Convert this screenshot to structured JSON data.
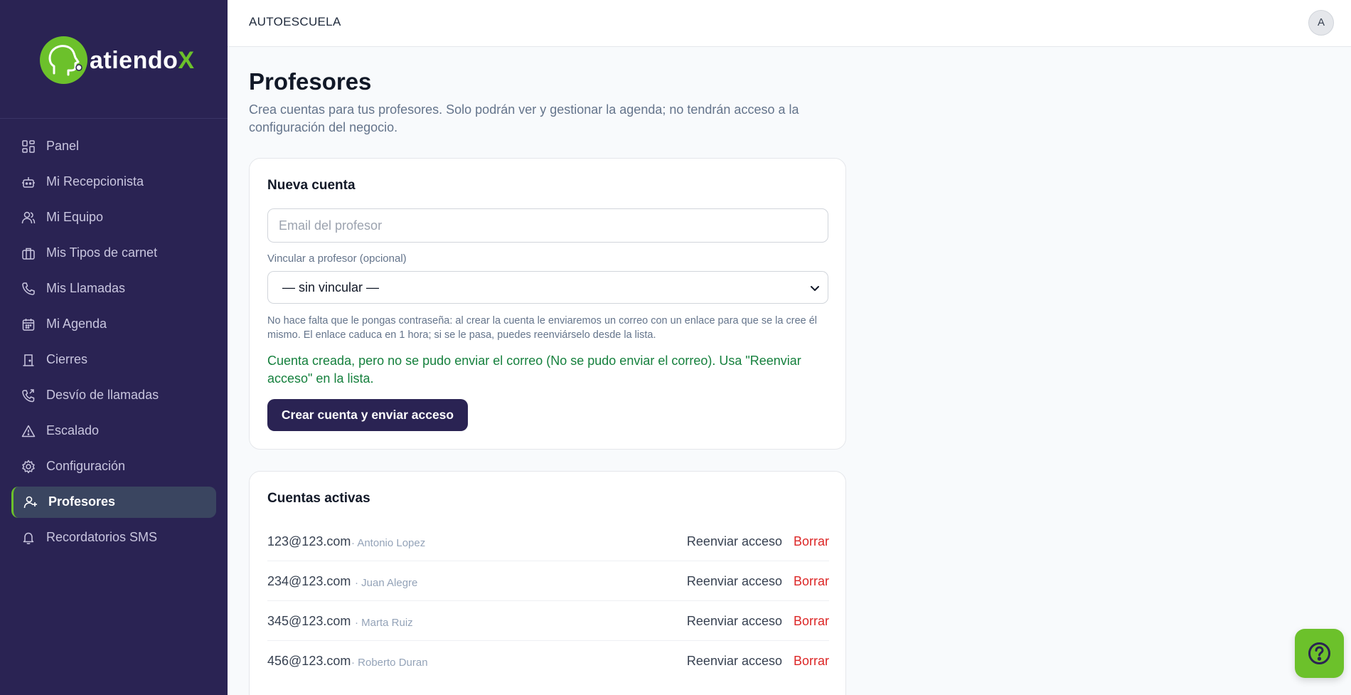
{
  "brand": {
    "name_prefix": "atiendo",
    "name_suffix": "X",
    "accent": "#6cc12b",
    "sidebar_bg": "#2a2353"
  },
  "sidebar": {
    "items": [
      {
        "label": "Panel",
        "icon": "dashboard-icon"
      },
      {
        "label": "Mi Recepcionista",
        "icon": "robot-icon"
      },
      {
        "label": "Mi Equipo",
        "icon": "users-icon"
      },
      {
        "label": "Mis Tipos de carnet",
        "icon": "briefcase-icon"
      },
      {
        "label": "Mis Llamadas",
        "icon": "phone-icon"
      },
      {
        "label": "Mi Agenda",
        "icon": "calendar-icon"
      },
      {
        "label": "Cierres",
        "icon": "door-icon"
      },
      {
        "label": "Desvío de llamadas",
        "icon": "phone-forward-icon"
      },
      {
        "label": "Escalado",
        "icon": "warning-icon"
      },
      {
        "label": "Configuración",
        "icon": "gear-icon"
      },
      {
        "label": "Profesores",
        "icon": "user-plus-icon",
        "active": true
      },
      {
        "label": "Recordatorios SMS",
        "icon": "bell-icon"
      }
    ]
  },
  "header": {
    "business": "AUTOESCUELA",
    "avatar_initial": "A"
  },
  "page": {
    "title": "Profesores",
    "description": "Crea cuentas para tus profesores. Solo podrán ver y gestionar la agenda; no tendrán acceso a la configuración del negocio."
  },
  "new_account": {
    "title": "Nueva cuenta",
    "email_placeholder": "Email del profesor",
    "email_value": "",
    "link_label": "Vincular a profesor (opcional)",
    "link_selected": "— sin vincular —",
    "hint": "No hace falta que le pongas contraseña: al crear la cuenta le enviaremos un correo con un enlace para que se la cree él mismo. El enlace caduca en 1 hora; si se le pasa, puedes reenviárselo desde la lista.",
    "status_message": "Cuenta creada, pero no se pudo enviar el correo (No se pudo enviar el correo). Usa \"Reenviar acceso\" en la lista.",
    "submit_label": "Crear cuenta y enviar acceso"
  },
  "active_accounts": {
    "title": "Cuentas activas",
    "rows": [
      {
        "email": "123@123.com",
        "name": "· Antonio Lopez",
        "resend": "Reenviar acceso",
        "delete": "Borrar"
      },
      {
        "email": "234@123.com",
        "name": "· Juan Alegre",
        "resend": "Reenviar acceso",
        "delete": "Borrar"
      },
      {
        "email": "345@123.com",
        "name": "· Marta Ruiz",
        "resend": "Reenviar acceso",
        "delete": "Borrar"
      },
      {
        "email": "456@123.com",
        "name": "· Roberto Duran",
        "resend": "Reenviar acceso",
        "delete": "Borrar"
      }
    ]
  },
  "help_button": {
    "icon": "help-icon"
  }
}
